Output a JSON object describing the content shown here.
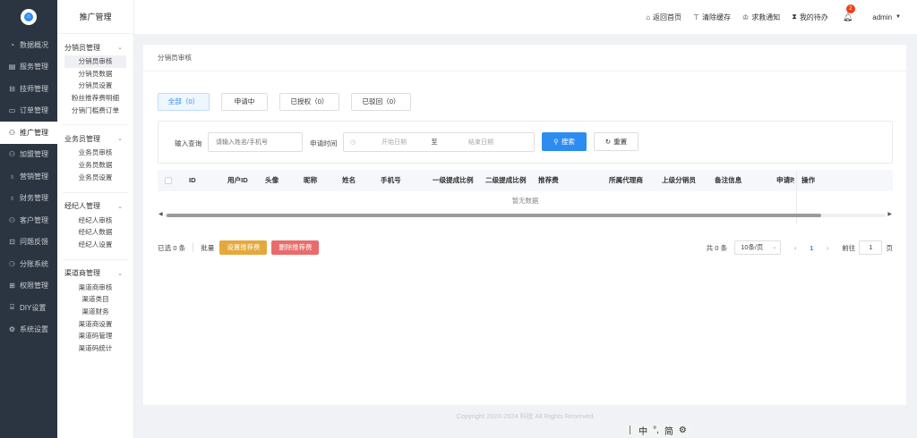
{
  "sidebar": {
    "items": [
      {
        "label": "数据概况",
        "icon": "gauge-icon",
        "glyph": "◔",
        "active": false
      },
      {
        "label": "服务管理",
        "icon": "service-icon",
        "glyph": "▤",
        "active": false
      },
      {
        "label": "技师管理",
        "icon": "technician-icon",
        "glyph": "⊟",
        "active": false
      },
      {
        "label": "订单管理",
        "icon": "order-icon",
        "glyph": "▭",
        "active": false
      },
      {
        "label": "推广管理",
        "icon": "promotion-icon",
        "glyph": "⚇",
        "active": true
      },
      {
        "label": "加盟管理",
        "icon": "franchise-icon",
        "glyph": "⚇",
        "active": false
      },
      {
        "label": "营销管理",
        "icon": "marketing-icon",
        "glyph": "♁",
        "active": false
      },
      {
        "label": "财务管理",
        "icon": "finance-icon",
        "glyph": "♁",
        "active": false
      },
      {
        "label": "客户管理",
        "icon": "customer-icon",
        "glyph": "⚇",
        "active": false
      },
      {
        "label": "问题反馈",
        "icon": "feedback-icon",
        "glyph": "⊡",
        "active": false
      },
      {
        "label": "分账系统",
        "icon": "split-icon",
        "glyph": "⚆",
        "active": false
      },
      {
        "label": "权限管理",
        "icon": "permission-icon",
        "glyph": "⊞",
        "active": false
      },
      {
        "label": "DIY设置",
        "icon": "diy-icon",
        "glyph": "⌸",
        "active": false
      },
      {
        "label": "系统设置",
        "icon": "settings-icon",
        "glyph": "⚙",
        "active": false
      }
    ]
  },
  "submenu": {
    "title": "推广管理",
    "groups": [
      {
        "label": "分销员管理",
        "items": [
          "分销员审核",
          "分销员数据",
          "分销员设置",
          "粉丝推荐费明细",
          "分销门槛费订单"
        ]
      },
      {
        "label": "业务员管理",
        "items": [
          "业务员审核",
          "业务员数据",
          "业务员设置"
        ]
      },
      {
        "label": "经纪人管理",
        "items": [
          "经纪人审核",
          "经纪人数据",
          "经纪人设置"
        ]
      },
      {
        "label": "渠道商管理",
        "items": [
          "渠道商审核",
          "渠道类目",
          "渠道财务",
          "渠道商设置",
          "渠道码管理",
          "渠道码统计"
        ]
      }
    ]
  },
  "header": {
    "home": "返回首页",
    "clear_cache": "清除缓存",
    "rescue": "求救通知",
    "todo": "我的待办",
    "badge": "2",
    "user": "admin"
  },
  "breadcrumb": "分销员审核",
  "tabs": [
    "全部（0）",
    "申请中",
    "已授权（0）",
    "已驳回（0）"
  ],
  "filter": {
    "query_label": "输入查询",
    "query_placeholder": "请输入姓名/手机号",
    "time_label": "申请时间",
    "start": "开始日期",
    "to": "至",
    "end": "结束日期",
    "search": "搜索",
    "reset": "重置"
  },
  "table": {
    "columns": [
      "ID",
      "用户ID",
      "头像",
      "昵称",
      "姓名",
      "手机号",
      "一级提成比例",
      "二级提成比例",
      "推荐费",
      "所属代理商",
      "上级分销员",
      "备注信息",
      "申请时",
      "操作"
    ],
    "empty": "暂无数据"
  },
  "footer": {
    "selected": "已选 0 条",
    "batch": "批量",
    "set_fee": "设置推荐费",
    "del_fee": "删除推荐费",
    "total": "共 0 条",
    "page_size": "10条/页",
    "page": "1",
    "goto": "前往",
    "goto_value": "1",
    "page_unit": "页"
  },
  "copyright": "Copyright 2020-2024 科技 All Rights Reserved.",
  "ime": {
    "a": "中",
    "b": "°,",
    "c": "简"
  }
}
